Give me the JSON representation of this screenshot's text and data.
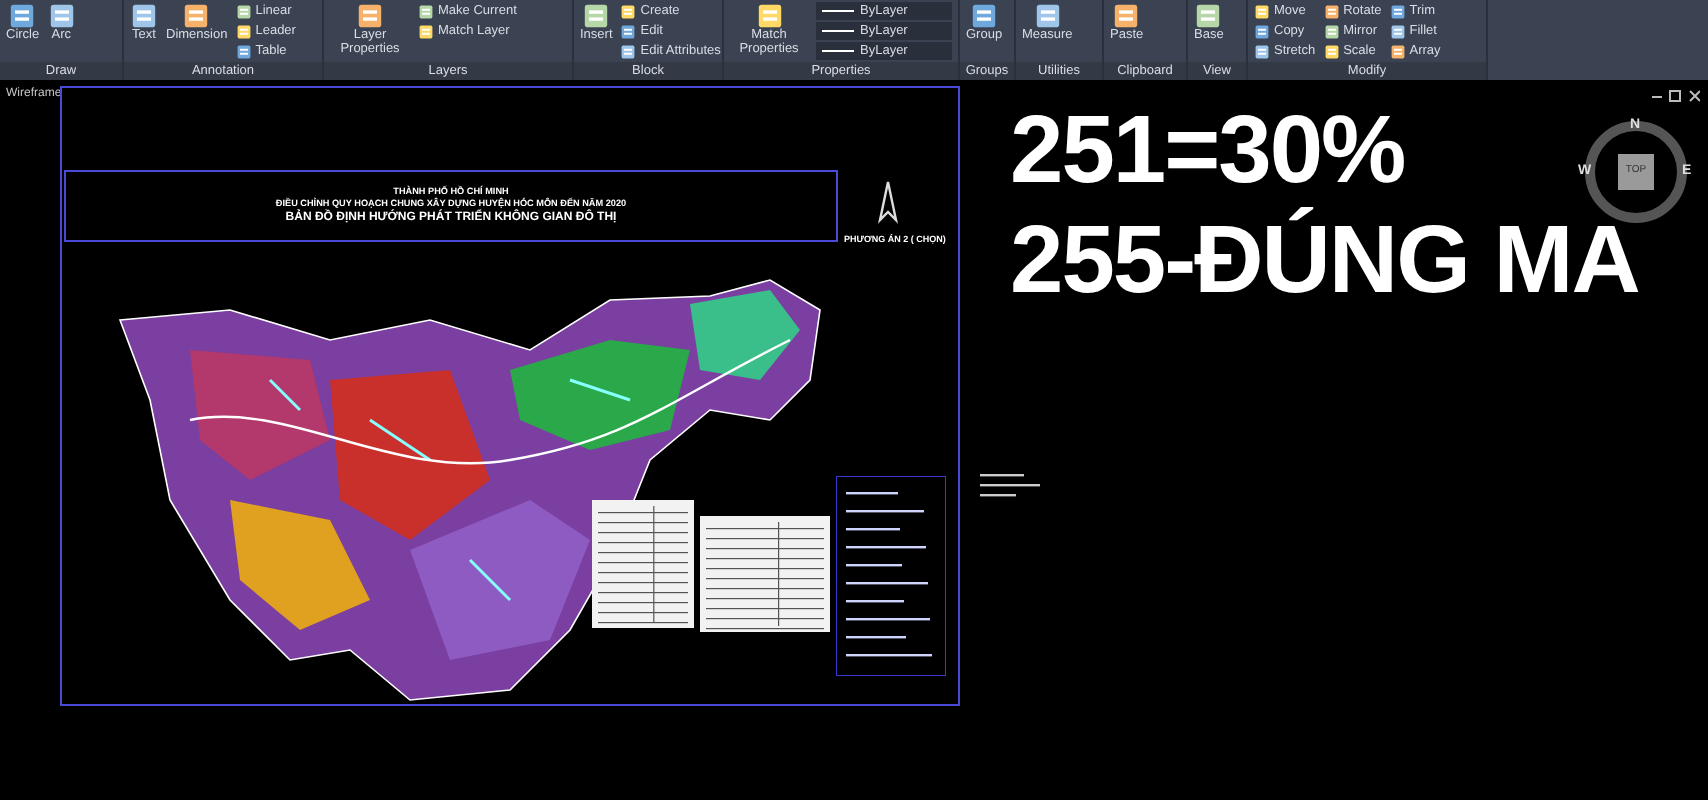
{
  "ribbon": {
    "panels": [
      {
        "title": "Draw",
        "tools": [
          {
            "label": "Circle",
            "kind": "large"
          },
          {
            "label": "Arc",
            "kind": "large"
          }
        ]
      },
      {
        "title": "Annotation",
        "tools": [
          {
            "label": "Text",
            "kind": "large"
          },
          {
            "label": "Dimension",
            "kind": "large"
          },
          {
            "label": "Linear",
            "kind": "small"
          },
          {
            "label": "Leader",
            "kind": "small"
          },
          {
            "label": "Table",
            "kind": "small"
          }
        ]
      },
      {
        "title": "Layers",
        "tools": [
          {
            "label": "Layer Properties",
            "kind": "large"
          },
          {
            "label": "Make Current",
            "kind": "small"
          },
          {
            "label": "Match Layer",
            "kind": "small"
          }
        ]
      },
      {
        "title": "Block",
        "tools": [
          {
            "label": "Insert",
            "kind": "large"
          },
          {
            "label": "Create",
            "kind": "small"
          },
          {
            "label": "Edit",
            "kind": "small"
          },
          {
            "label": "Edit Attributes",
            "kind": "small"
          }
        ]
      },
      {
        "title": "Properties",
        "tools": [
          {
            "label": "Match Properties",
            "kind": "large"
          },
          {
            "label": "ByLayer",
            "kind": "dropdown"
          },
          {
            "label": "ByLayer",
            "kind": "dropdown"
          },
          {
            "label": "ByLayer",
            "kind": "dropdown"
          }
        ]
      },
      {
        "title": "Groups",
        "tools": [
          {
            "label": "Group",
            "kind": "large"
          }
        ]
      },
      {
        "title": "Utilities",
        "tools": [
          {
            "label": "Measure",
            "kind": "large"
          }
        ]
      },
      {
        "title": "Clipboard",
        "tools": [
          {
            "label": "Paste",
            "kind": "large"
          }
        ]
      },
      {
        "title": "View",
        "tools": [
          {
            "label": "Base",
            "kind": "large"
          }
        ]
      },
      {
        "title": "Modify",
        "tools": [
          {
            "label": "Move",
            "kind": "small"
          },
          {
            "label": "Copy",
            "kind": "small"
          },
          {
            "label": "Stretch",
            "kind": "small"
          },
          {
            "label": "Rotate",
            "kind": "small"
          },
          {
            "label": "Mirror",
            "kind": "small"
          },
          {
            "label": "Scale",
            "kind": "small"
          },
          {
            "label": "Trim",
            "kind": "small"
          },
          {
            "label": "Fillet",
            "kind": "small"
          },
          {
            "label": "Array",
            "kind": "small"
          }
        ]
      }
    ]
  },
  "viewport": {
    "label": "Wireframe",
    "viewcube": {
      "north": "N",
      "west": "W",
      "east": "E",
      "face": "TOP"
    }
  },
  "drawing": {
    "title_lines": [
      "THÀNH PHỐ HỒ CHÍ MINH",
      "ĐIỀU CHỈNH QUY HOẠCH CHUNG XÂY DỰNG HUYỆN HÓC MÔN ĐẾN NĂM 2020",
      "BẢN ĐỒ ĐỊNH HƯỚNG PHÁT TRIỂN KHÔNG GIAN ĐÔ THỊ"
    ],
    "option_label": "PHƯƠNG ÁN 2 ( CHỌN)"
  },
  "headline": {
    "lines": [
      "251=30%",
      "255-ĐÚNG MA"
    ]
  }
}
